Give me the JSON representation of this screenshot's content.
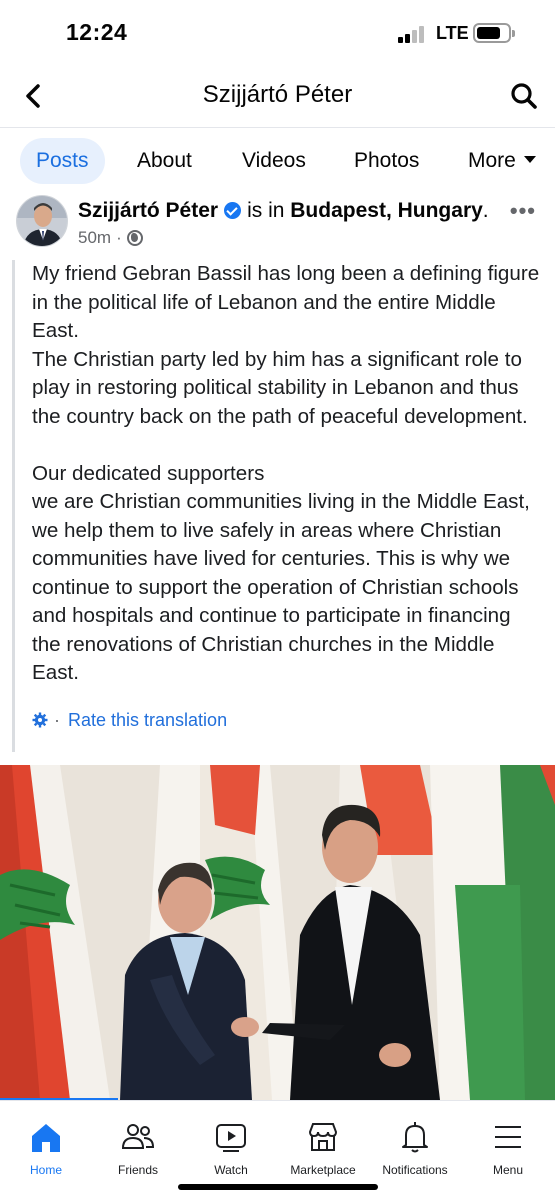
{
  "status_bar": {
    "time": "12:24",
    "network": "LTE"
  },
  "header": {
    "title": "Szijjártó Péter"
  },
  "tabs": [
    {
      "label": "Posts",
      "active": true
    },
    {
      "label": "About",
      "active": false
    },
    {
      "label": "Videos",
      "active": false
    },
    {
      "label": "Photos",
      "active": false
    },
    {
      "label": "More",
      "active": false
    }
  ],
  "post": {
    "author": "Szijjártó Péter",
    "location_prefix": "is in",
    "location": "Budapest, Hungary",
    "location_suffix": ".",
    "time": "50m",
    "text": "My friend Gebran Bassil has long been a defining figure in the political life of Lebanon and the entire Middle East.\nThe Christian party led by him has a significant role to play in restoring political stability in Lebanon and thus the country back on the path of peaceful development.\n\nOur dedicated supporters\nwe are Christian communities living in the Middle East, we help them to live safely in areas where Christian communities have lived for centuries. This is why we continue to support the operation of Christian schools and hospitals and continue to participate in financing the renovations of Christian churches in the Middle East.",
    "translation_separator": "·",
    "translation_link": "Rate this translation"
  },
  "bottom_nav": [
    {
      "label": "Home",
      "icon": "home-icon",
      "active": true
    },
    {
      "label": "Friends",
      "icon": "friends-icon",
      "active": false
    },
    {
      "label": "Watch",
      "icon": "watch-icon",
      "active": false
    },
    {
      "label": "Marketplace",
      "icon": "marketplace-icon",
      "active": false
    },
    {
      "label": "Notifications",
      "icon": "bell-icon",
      "active": false
    },
    {
      "label": "Menu",
      "icon": "menu-icon",
      "active": false
    }
  ],
  "colors": {
    "accent": "#1877f2",
    "link": "#216fdb",
    "tab_active_bg": "#e7f0fd"
  }
}
